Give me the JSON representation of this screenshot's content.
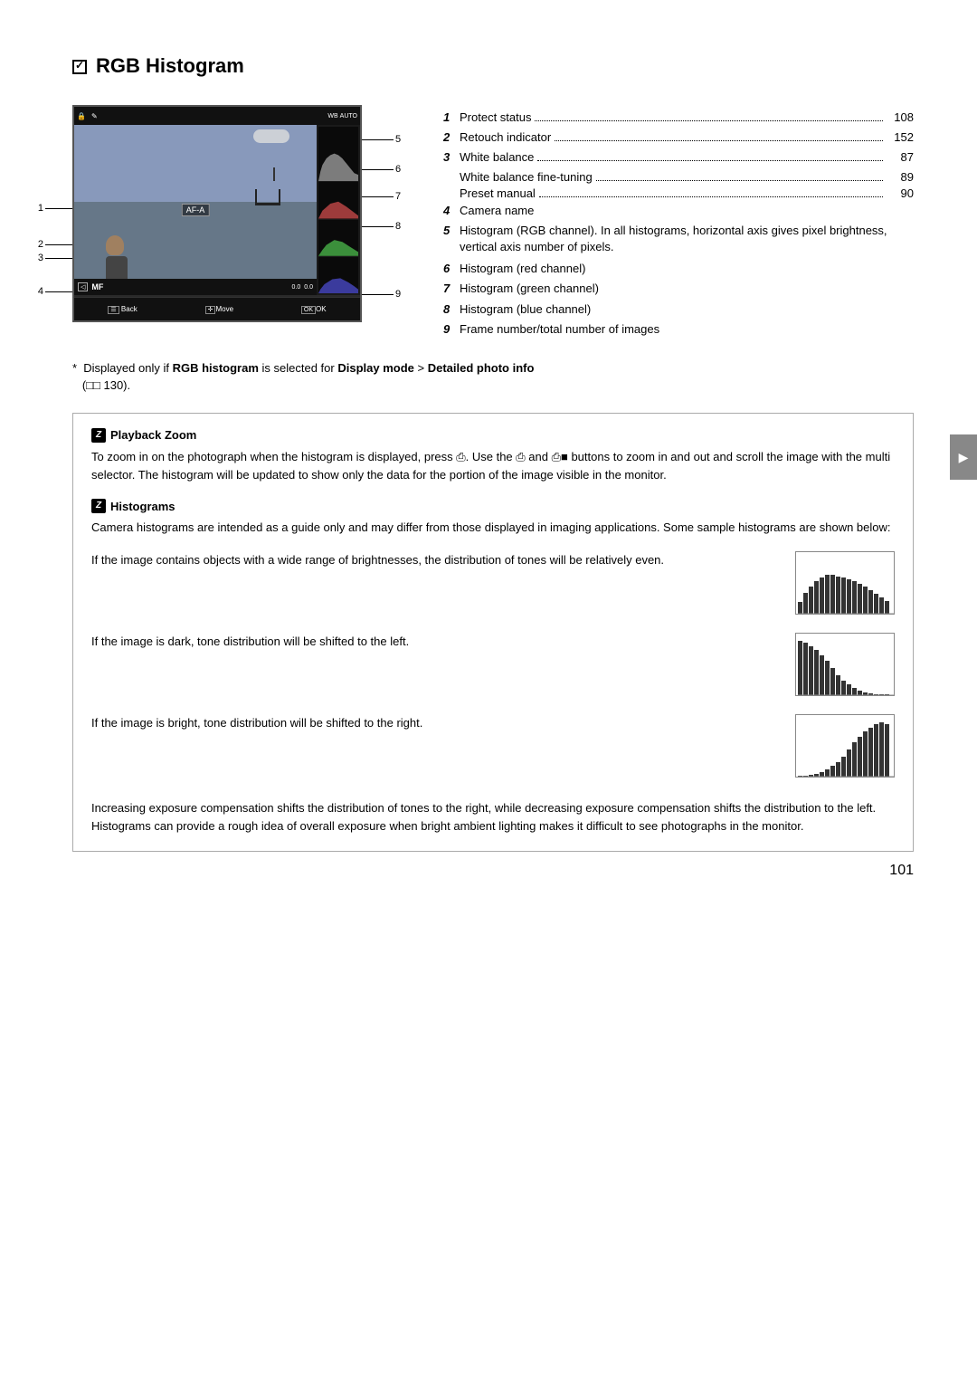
{
  "page": {
    "title": "RGB Histogram",
    "title_checkbox": "✓",
    "page_number": "101"
  },
  "camera": {
    "af_label": "AF-A",
    "mf_label": "MF"
  },
  "info_items": [
    {
      "num": "1",
      "label": "Protect status",
      "dots": true,
      "page": "108"
    },
    {
      "num": "2",
      "label": "Retouch indicator",
      "dots": true,
      "page": "152"
    },
    {
      "num": "3",
      "label": "White balance",
      "dots": true,
      "page": "87",
      "sub": [
        {
          "label": "White balance fine-tuning",
          "dots": true,
          "page": "89"
        },
        {
          "label": "Preset manual",
          "dots": true,
          "page": "90"
        }
      ]
    },
    {
      "num": "4",
      "label": "Camera name",
      "dots": false
    },
    {
      "num": "5",
      "label": "Histogram (RGB channel).  In all histograms, horizontal axis gives pixel brightness, vertical axis number of pixels.",
      "dots": false
    },
    {
      "num": "6",
      "label": "Histogram (red channel)",
      "dots": false
    },
    {
      "num": "7",
      "label": "Histogram (green channel)",
      "dots": false
    },
    {
      "num": "8",
      "label": "Histogram (blue channel)",
      "dots": false
    },
    {
      "num": "9",
      "label": "Frame number/total number of images",
      "dots": false
    }
  ],
  "diagram_numbers_left": [
    "1",
    "2",
    "3",
    "4"
  ],
  "diagram_numbers_right": [
    "5",
    "6",
    "7",
    "8",
    "9"
  ],
  "footnote": {
    "asterisk": "*",
    "text": "Displayed only if ",
    "bold1": "RGB histogram",
    "text2": " is selected for ",
    "bold2": "Display mode",
    "arrow": " > ",
    "bold3": "Detailed photo info",
    "text3": "\n(¤¤ 130).",
    "ref": "(□□ 130)."
  },
  "notes": {
    "playback_zoom": {
      "title": "Playback Zoom",
      "icon": "Z",
      "text": "To zoom in on the photograph when the histogram is displayed, press ⒡.  Use the ⒡ and ⒡■ buttons to zoom in and out and scroll the image with the multi selector.  The histogram will be updated to show only the data for the portion of the image visible in the monitor."
    },
    "histograms": {
      "title": "Histograms",
      "icon": "Z",
      "text": "Camera histograms are intended as a guide only and may differ from those displayed in imaging applications.  Some sample histograms are shown below:"
    }
  },
  "histogram_examples": [
    {
      "text": "If the image contains objects with a wide range of brightnesses, the distribution of tones will be relatively even.",
      "bars": [
        20,
        35,
        50,
        60,
        58,
        55,
        52,
        48,
        45,
        42,
        40,
        38,
        35,
        32,
        30,
        28,
        25,
        22,
        20,
        18
      ]
    },
    {
      "text": "If the image is dark, tone distribution will be shifted to the left.",
      "bars": [
        60,
        65,
        68,
        62,
        55,
        48,
        40,
        32,
        25,
        18,
        12,
        8,
        5,
        3,
        2,
        2,
        1,
        1,
        1,
        1
      ]
    },
    {
      "text": "If the image is bright, tone distribution will be shifted to the right.",
      "bars": [
        1,
        1,
        1,
        2,
        3,
        5,
        8,
        12,
        18,
        25,
        32,
        40,
        48,
        55,
        62,
        68,
        65,
        60,
        55,
        50
      ]
    }
  ],
  "exposure_text": "Increasing exposure compensation shifts the distribution of tones to the right, while decreasing exposure compensation shifts the distribution to the left.  Histograms can provide a rough idea of overall exposure when bright ambient lighting makes it difficult to see photographs in the monitor.",
  "side_tab_icon": "▶"
}
